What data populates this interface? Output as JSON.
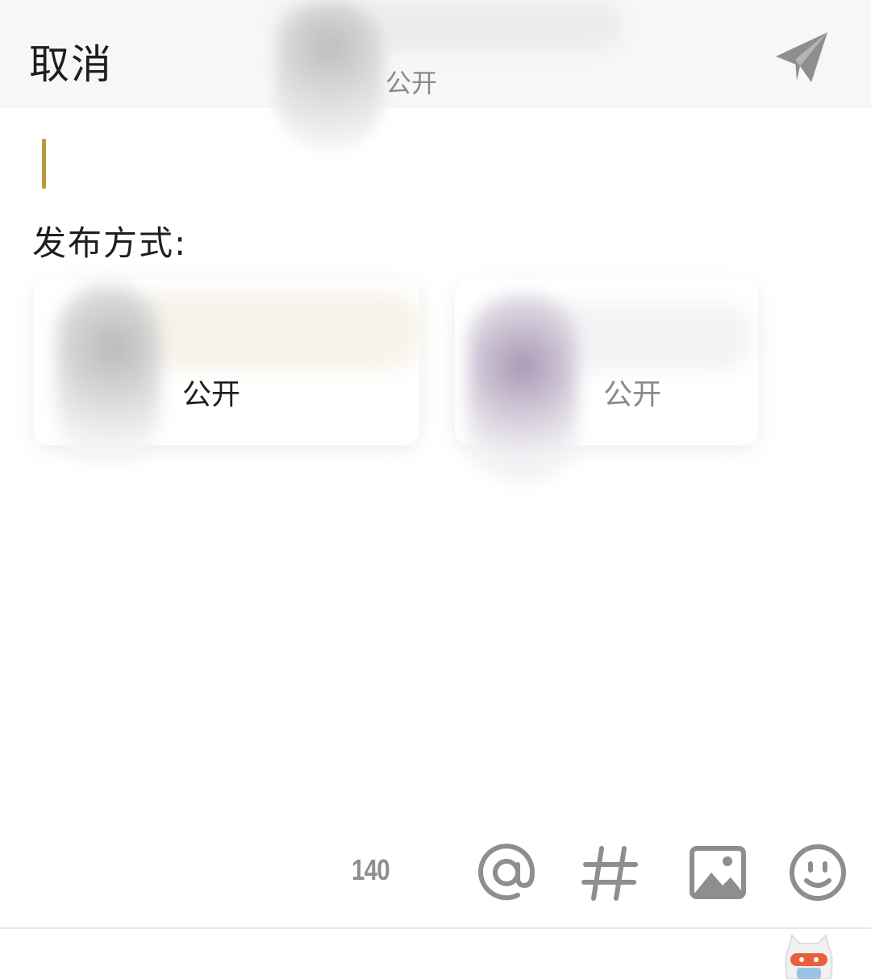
{
  "header": {
    "cancel_label": "取消",
    "visibility_label": "公开",
    "send_icon": "paper-plane-icon"
  },
  "compose": {
    "text": ""
  },
  "publish": {
    "label": "发布方式:",
    "options": [
      {
        "label": "公开",
        "selected": true
      },
      {
        "label": "公开",
        "selected": false
      }
    ]
  },
  "toolbar": {
    "char_count": "140",
    "icons": [
      "at-icon",
      "hashtag-icon",
      "image-icon",
      "emoji-icon"
    ]
  },
  "colors": {
    "caret": "#b89a3c",
    "icon_gray": "#8e8e8e",
    "header_bg": "#f7f7f7"
  }
}
